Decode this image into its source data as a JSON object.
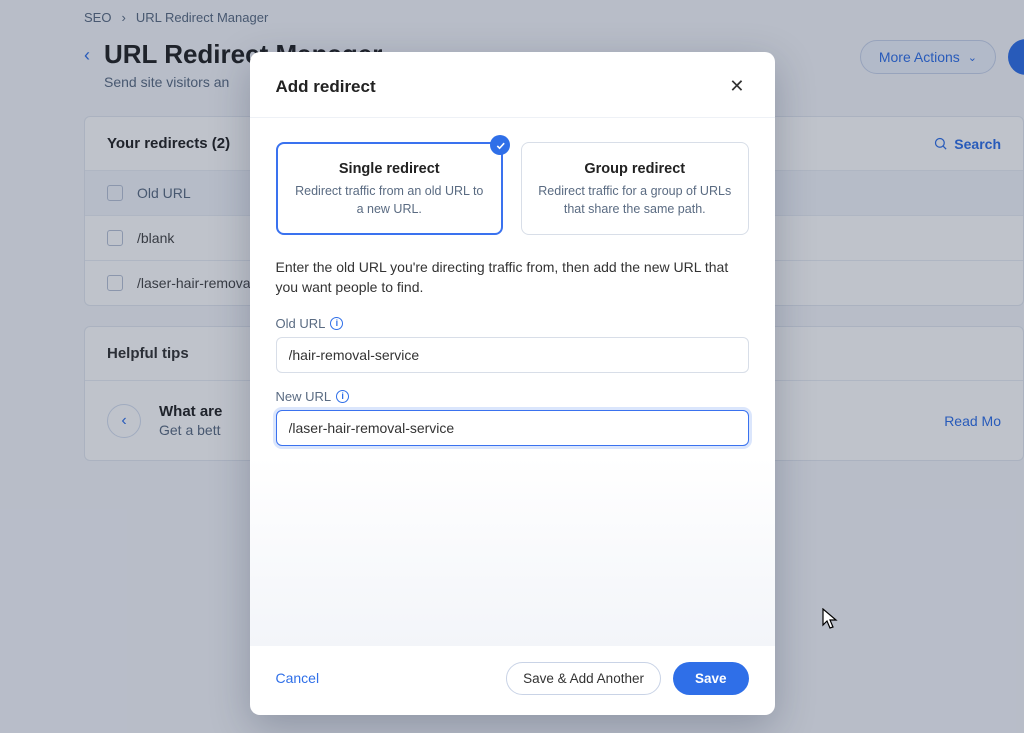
{
  "breadcrumb": {
    "root": "SEO",
    "current": "URL Redirect Manager"
  },
  "header": {
    "title": "URL Redirect Manager",
    "subtitle": "Send site visitors an",
    "more_label": "More Actions"
  },
  "panel": {
    "title": "Your redirects (2)",
    "search_label": "Search",
    "col_old": "Old URL",
    "rows": [
      "/blank",
      "/laser-hair-removal"
    ]
  },
  "tips": {
    "title": "Helpful tips",
    "question": "What are",
    "answer": "Get a bett",
    "read": "Read Mo"
  },
  "modal": {
    "title": "Add redirect",
    "options": [
      {
        "title": "Single redirect",
        "desc": "Redirect traffic from an old URL to a new URL."
      },
      {
        "title": "Group redirect",
        "desc": "Redirect traffic for a group of URLs that share the same path."
      }
    ],
    "instruction": "Enter the old URL you're directing traffic from, then add the new URL that you want people to find.",
    "old_label": "Old URL",
    "old_value": "/hair-removal-service",
    "new_label": "New URL",
    "new_value": "/laser-hair-removal-service",
    "cancel": "Cancel",
    "save_another": "Save & Add Another",
    "save": "Save"
  }
}
